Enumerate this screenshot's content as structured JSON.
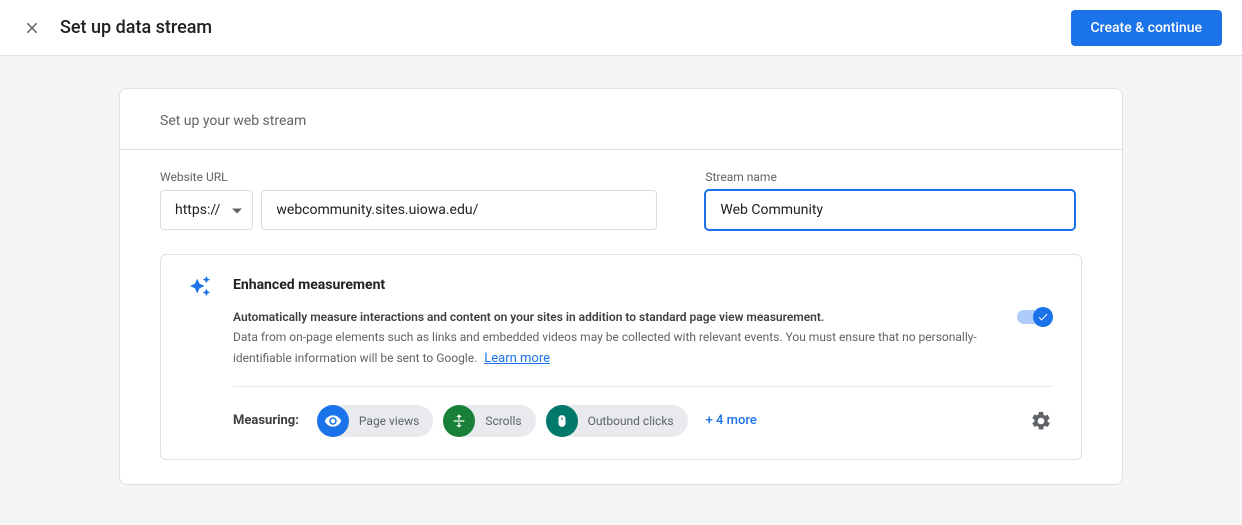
{
  "header": {
    "title": "Set up data stream",
    "primary_action": "Create & continue"
  },
  "section_title": "Set up your web stream",
  "fields": {
    "url_label": "Website URL",
    "protocol": "https://",
    "url_value": "webcommunity.sites.uiowa.edu/",
    "stream_label": "Stream name",
    "stream_value": "Web Community"
  },
  "enhanced": {
    "title": "Enhanced measurement",
    "desc_bold": "Automatically measure interactions and content on your sites in addition to standard page view measurement.",
    "desc_rest": "Data from on-page elements such as links and embedded videos may be collected with relevant events. You must ensure that no personally-identifiable information will be sent to Google.",
    "learn_more": "Learn more",
    "measuring_label": "Measuring:",
    "chips": [
      {
        "label": "Page views"
      },
      {
        "label": "Scrolls"
      },
      {
        "label": "Outbound clicks"
      }
    ],
    "more": "+ 4 more"
  }
}
